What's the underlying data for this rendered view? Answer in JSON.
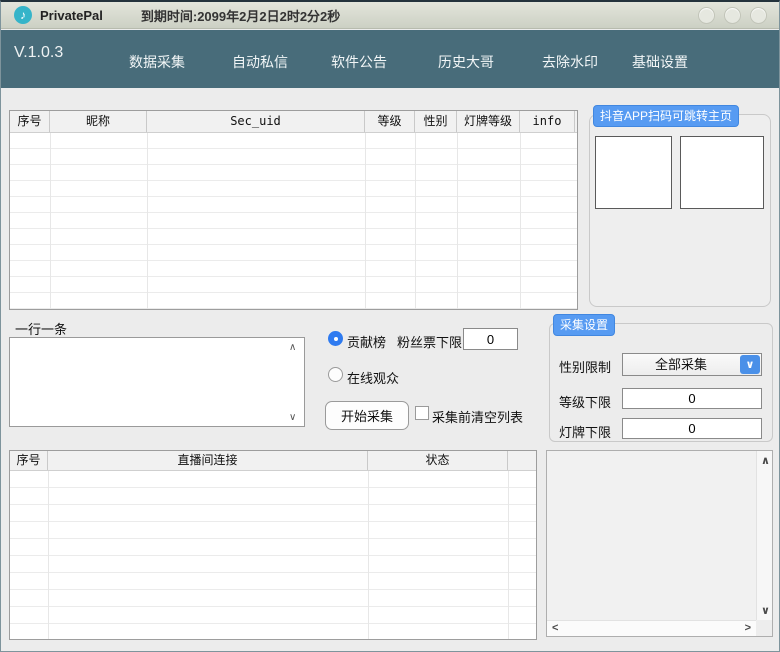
{
  "window": {
    "app_title": "PrivatePal",
    "expiry_text": "到期时间:2099年2月2日2时2分2秒"
  },
  "navbar": {
    "version": "V.1.0.3",
    "items": [
      {
        "label": "数据采集"
      },
      {
        "label": "自动私信"
      },
      {
        "label": "软件公告"
      },
      {
        "label": "历史大哥"
      },
      {
        "label": "去除水印"
      },
      {
        "label": "基础设置"
      }
    ]
  },
  "members_table": {
    "columns": [
      "序号",
      "昵称",
      "Sec_uid",
      "等级",
      "性别",
      "灯牌等级",
      "info"
    ],
    "rows": []
  },
  "qr_panel": {
    "title": "抖音APP扫码可跳转主页"
  },
  "collect": {
    "lines_hint": "一行一条",
    "textarea_value": "",
    "radio_contribution": "贡献榜",
    "fan_ticket_label": "粉丝票下限",
    "fan_ticket_value": "0",
    "radio_online": "在线观众",
    "start_button": "开始采集",
    "clear_checkbox_label": "采集前清空列表"
  },
  "settings": {
    "title": "采集设置",
    "gender_label": "性别限制",
    "gender_value": "全部采集",
    "level_label": "等级下限",
    "level_value": "0",
    "lamp_label": "灯牌下限",
    "lamp_value": "0"
  },
  "rooms_table": {
    "columns": [
      "序号",
      "直播间连接",
      "状态"
    ],
    "rows": []
  },
  "icons": {
    "app": "♪",
    "dropdown": "∨",
    "up": "∧",
    "down": "∨",
    "left": "<",
    "right": ">"
  },
  "colors": {
    "navbar": "#486c7a",
    "badge_blue": "#579bf2",
    "accent_blue": "#2f7bf0",
    "titlebar": "#d8dbd0",
    "background": "#ececec"
  }
}
